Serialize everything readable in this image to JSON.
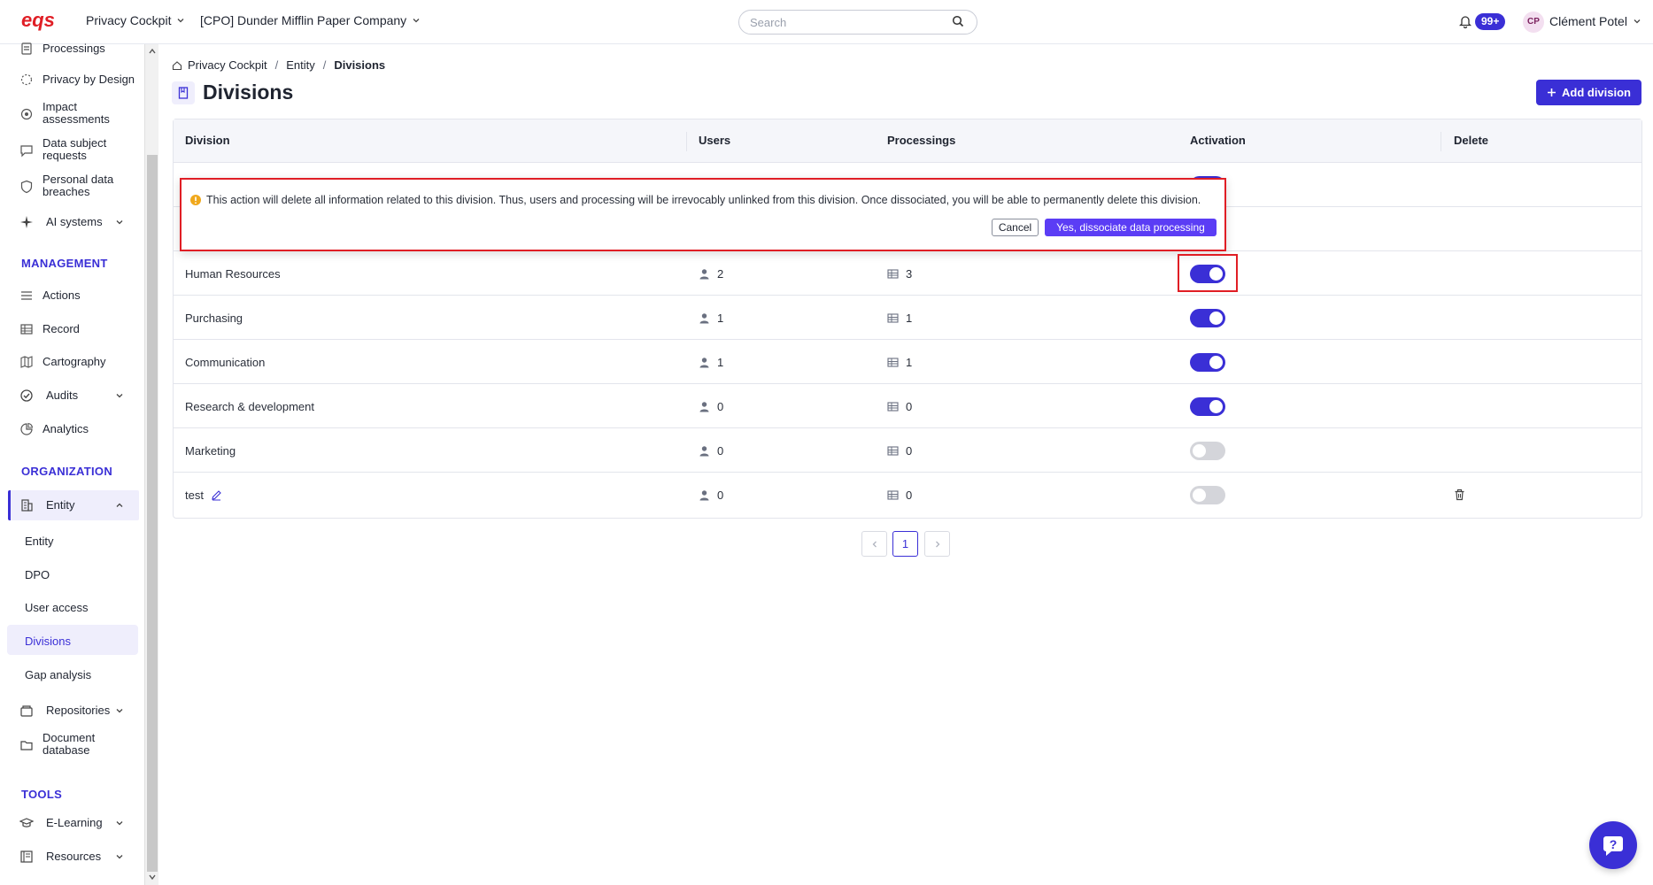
{
  "header": {
    "logo_text": "eqs",
    "app_menu": "Privacy Cockpit",
    "company_menu": "[CPO] Dunder Mifflin Paper Company",
    "search_placeholder": "Search",
    "notifications": "99+",
    "user_initials": "CP",
    "user_name": "Clément Potel"
  },
  "sidebar": {
    "items_top": [
      {
        "label": "Processings",
        "icon": "processing-icon"
      },
      {
        "label": "Privacy by Design",
        "icon": "design-icon"
      },
      {
        "label": "Impact assessments",
        "icon": "impact-icon"
      },
      {
        "label": "Data subject requests",
        "icon": "requests-icon"
      },
      {
        "label": "Personal data breaches",
        "icon": "shield-icon"
      },
      {
        "label": "AI systems",
        "icon": "sparkle-icon"
      }
    ],
    "section_management": "MANAGEMENT",
    "items_management": [
      {
        "label": "Actions",
        "icon": "list-icon"
      },
      {
        "label": "Record",
        "icon": "table-icon"
      },
      {
        "label": "Cartography",
        "icon": "map-icon"
      },
      {
        "label": "Audits",
        "icon": "check-circle-icon"
      },
      {
        "label": "Analytics",
        "icon": "chart-icon"
      }
    ],
    "section_organization": "ORGANIZATION",
    "entity_label": "Entity",
    "entity_subitems": [
      "Entity",
      "DPO",
      "User access",
      "Divisions",
      "Gap analysis"
    ],
    "items_org_bottom": [
      {
        "label": "Repositories",
        "icon": "layers-icon"
      },
      {
        "label": "Document database",
        "icon": "folder-icon"
      }
    ],
    "section_tools": "TOOLS",
    "items_tools": [
      {
        "label": "E-Learning",
        "icon": "graduation-icon"
      },
      {
        "label": "Resources",
        "icon": "book-icon"
      }
    ]
  },
  "breadcrumb": {
    "home": "Privacy Cockpit",
    "level2": "Entity",
    "current": "Divisions"
  },
  "page": {
    "title": "Divisions",
    "add_button": "Add division"
  },
  "table": {
    "columns": [
      "Division",
      "Users",
      "Processings",
      "Activation",
      "Delete"
    ],
    "rows": [
      {
        "name": "",
        "users": "",
        "processings": "",
        "active": true,
        "deletable": false
      },
      {
        "name": "",
        "users": "",
        "processings": "",
        "active": true,
        "deletable": false
      },
      {
        "name": "Human Resources",
        "users": "2",
        "processings": "3",
        "active": true,
        "deletable": false
      },
      {
        "name": "Purchasing",
        "users": "1",
        "processings": "1",
        "active": true,
        "deletable": false
      },
      {
        "name": "Communication",
        "users": "1",
        "processings": "1",
        "active": true,
        "deletable": false
      },
      {
        "name": "Research & development",
        "users": "0",
        "processings": "0",
        "active": true,
        "deletable": false
      },
      {
        "name": "Marketing",
        "users": "0",
        "processings": "0",
        "active": false,
        "deletable": false
      },
      {
        "name": "test",
        "users": "0",
        "processings": "0",
        "active": false,
        "deletable": true
      }
    ]
  },
  "popup": {
    "message": "This action will delete all information related to this division. Thus, users and processing will be irrevocably unlinked from this division. Once dissociated, you will be able to permanently delete this division.",
    "cancel": "Cancel",
    "confirm": "Yes, dissociate data processing"
  },
  "pagination": {
    "current_page": "1"
  },
  "colors": {
    "primary": "#3a2fd6",
    "brand_red": "#e01e25",
    "warning": "#f0a81c"
  }
}
